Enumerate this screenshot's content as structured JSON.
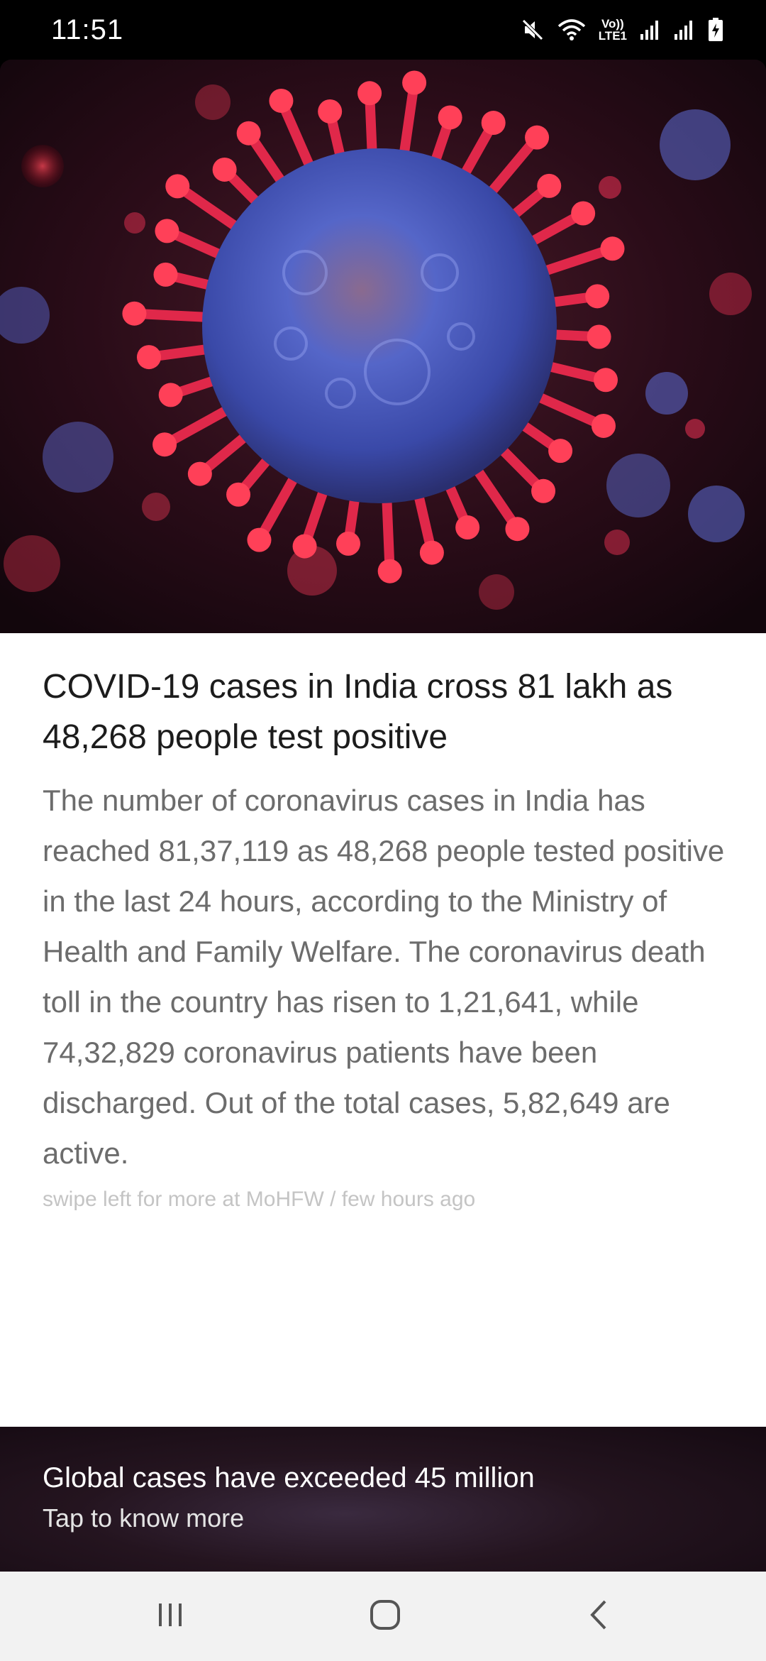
{
  "status_bar": {
    "time": "11:51",
    "network_label_top": "Vo))",
    "network_label_bottom": "LTE1",
    "icons": [
      "mute-icon",
      "wifi-icon",
      "signal-icon",
      "signal-icon",
      "battery-charging-icon"
    ]
  },
  "hero": {
    "image": "coronavirus-illustration",
    "colors": {
      "virus_core": "#4a5bbf",
      "spikes": "#e0284a",
      "background": "#1a0a12"
    }
  },
  "article": {
    "headline": "COVID-19 cases in India cross 81 lakh as 48,268 people test positive",
    "body": "The number of coronavirus cases in India has reached 81,37,119 as 48,268 people tested positive in the last 24 hours, according to the Ministry of Health and Family Welfare. The coronavirus death toll in the country has risen to 1,21,641, while 74,32,829 coronavirus patients have been discharged. Out of the total cases, 5,82,649 are active.",
    "source_line": "swipe left for more at MoHFW / few hours ago"
  },
  "banner": {
    "title": "Global cases have exceeded 45 million",
    "subtitle": "Tap to know more"
  },
  "nav_bar": {
    "icons": [
      "recent-apps-icon",
      "home-icon",
      "back-icon"
    ]
  }
}
